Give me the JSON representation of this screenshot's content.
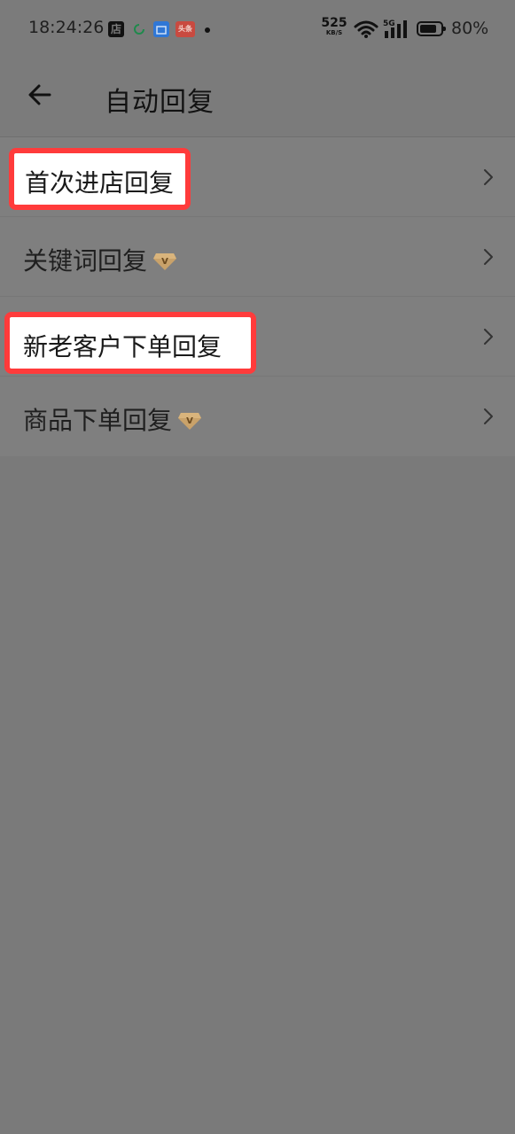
{
  "status_bar": {
    "time": "18:24:26",
    "app_icons": [
      "shop-icon",
      "sync-icon",
      "app-blue-icon",
      "news-icon"
    ],
    "shop_icon_label": "店",
    "news_icon_label": "头条",
    "net_speed_value": "525",
    "net_speed_unit": "KB/S",
    "network": "5G",
    "battery_percent": 80,
    "battery_text": "80%"
  },
  "header": {
    "title": "自动回复",
    "back_icon": "arrow-left-icon"
  },
  "menu": {
    "items": [
      {
        "label": "首次进店回复",
        "vip": false,
        "highlighted": true
      },
      {
        "label": "关键词回复",
        "vip": true,
        "highlighted": false
      },
      {
        "label": "新老客户下单回复",
        "vip": false,
        "highlighted": true
      },
      {
        "label": "商品下单回复",
        "vip": true,
        "highlighted": false
      }
    ]
  },
  "colors": {
    "background": "#7a7a7a",
    "highlight_border": "#ff3b3b",
    "vip_gold": "#c9a26a"
  }
}
